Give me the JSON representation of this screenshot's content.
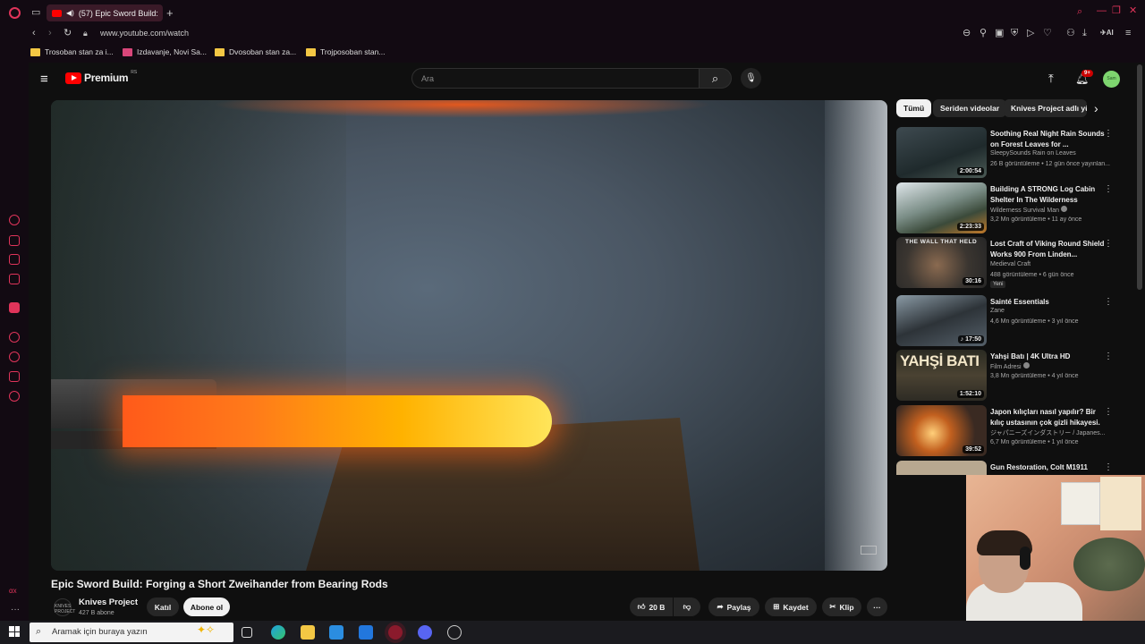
{
  "browser": {
    "tab_title": "(57) Epic Sword Build:",
    "url": "www.youtube.com/watch",
    "bookmarks": [
      "Trosoban stan za i...",
      "Izdavanje, Novi Sa...",
      "Dvosoban stan za...",
      "Trojposoban stan..."
    ],
    "ai_label": "AI",
    "bottom_label": "αx"
  },
  "youtube": {
    "logo_text": "Premium",
    "logo_badge": "RS",
    "search_placeholder": "Ara",
    "notifications_badge": "9+",
    "avatar_label": "Sam"
  },
  "video": {
    "title": "Epic Sword Build: Forging a Short Zweihander from Bearing Rods",
    "channel_name": "Knives Project",
    "channel_avatar_text": "KNIVES PROJECT",
    "subscribers": "427 B abone",
    "join_label": "Katıl",
    "subscribe_label": "Abone ol",
    "likes": "20 B",
    "share_label": "Paylaş",
    "save_label": "Kaydet",
    "clip_label": "Klip"
  },
  "chips": [
    "Tümü",
    "Seriden videolar",
    "Knives Project adlı yü"
  ],
  "recommendations": [
    {
      "title": "Soothing Real Night Rain Sounds on Forest Leaves for ...",
      "channel": "SleepySounds Rain on Leaves",
      "meta": "26 B görüntüleme • 12 gün önce yayınlan...",
      "duration": "2:00:54",
      "badge": ""
    },
    {
      "title": "Building A STRONG Log Cabin Shelter In The Wilderness",
      "channel": "Wilderness Survival Man",
      "meta": "3,2 Mn görüntüleme • 11 ay önce",
      "duration": "2:23:33",
      "badge": ""
    },
    {
      "title": "Lost Craft of Viking Round Shield Works 900 From Linden...",
      "channel": "Medieval Craft",
      "meta": "488 görüntüleme • 6 gün önce",
      "duration": "30:16",
      "badge": "Yeni",
      "thumb_text": "THE WALL THAT HELD"
    },
    {
      "title": "Sainté Essentials",
      "channel": "Zane",
      "meta": "4,6 Mn görüntüleme • 3 yıl önce",
      "duration": "17:50",
      "badge": ""
    },
    {
      "title": "Yahşi Batı | 4K Ultra HD",
      "channel": "Film Adresi",
      "meta": "3,8 Mn görüntüleme • 4 yıl önce",
      "duration": "1:52:10",
      "badge": "",
      "thumb_text": "YAHŞİ BATI"
    },
    {
      "title": "Japon kılıçları nasıl yapılır? Bir kılıç ustasının çok gizli hikayesi.",
      "channel": "ジャパニーズインダストリー / Japanes...",
      "meta": "6,7 Mn görüntüleme • 1 yıl önce",
      "duration": "39:52",
      "badge": ""
    },
    {
      "title": "Gun Restoration, Colt M1911",
      "channel": "",
      "meta": "",
      "duration": "",
      "badge": ""
    }
  ],
  "taskbar": {
    "search_placeholder": "Aramak için buraya yazın"
  },
  "colors": {
    "yt_red": "#ff0000",
    "opera_red": "#e0345a",
    "background": "#0f0f0f"
  }
}
